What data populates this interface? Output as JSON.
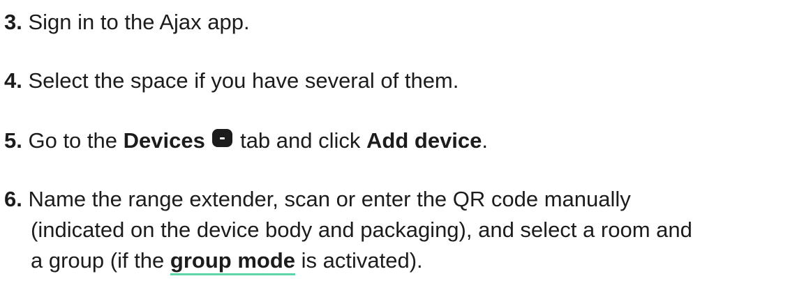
{
  "steps": [
    {
      "num": "3.",
      "text": " Sign in to the Ajax app."
    },
    {
      "num": "4.",
      "text": " Select the space if you have several of them."
    },
    {
      "num": "5.",
      "pre": " Go to the ",
      "bold1": "Devices",
      "icon": "devices-tab-icon",
      "mid": " tab and click ",
      "bold2": "Add device",
      "post": "."
    },
    {
      "num": "6.",
      "line1": " Name the range extender, scan or enter the QR code manually",
      "line2": "(indicated on the device body and packaging), and select a room and",
      "line3_pre": "a group (if the ",
      "link": "group mode",
      "line3_post": " is activated)."
    }
  ],
  "colors": {
    "text": "#1c1c1c",
    "link_underline": "#5dd5a8"
  }
}
